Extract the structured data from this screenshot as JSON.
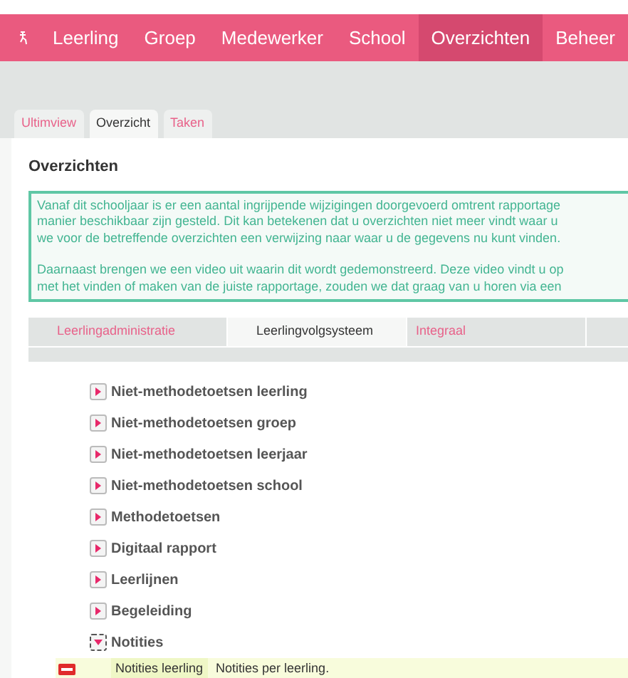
{
  "nav": {
    "items": [
      {
        "label": "Leerling",
        "selected": false
      },
      {
        "label": "Groep",
        "selected": false
      },
      {
        "label": "Medewerker",
        "selected": false
      },
      {
        "label": "School",
        "selected": false
      },
      {
        "label": "Overzichten",
        "selected": true
      },
      {
        "label": "Beheer",
        "selected": false
      }
    ]
  },
  "tabs": [
    {
      "label": "Ultimview",
      "selected": false
    },
    {
      "label": "Overzicht",
      "selected": true
    },
    {
      "label": "Taken",
      "selected": false
    }
  ],
  "title": "Overzichten",
  "notice": {
    "paragraphs": [
      [
        "Vanaf dit schooljaar is er een aantal ingrijpende wijzigingen doorgevoerd omtrent rapportage",
        "manier beschikbaar zijn gesteld. Dit kan betekenen dat u overzichten niet meer vindt waar u",
        "we voor de betreffende overzichten een verwijzing naar waar u de gegevens nu kunt vinden."
      ],
      [
        "Daarnaast brengen we een video uit waarin dit wordt gedemonstreerd. Deze video vindt u op",
        "met het vinden of maken van de juiste rapportage, zouden we dat graag van u horen via een"
      ]
    ]
  },
  "subtabs": [
    {
      "label": "Leerlingadministratie",
      "selected": false
    },
    {
      "label": "Leerlingvolgsysteem",
      "selected": true
    },
    {
      "label": "Integraal",
      "selected": false
    }
  ],
  "tree": [
    {
      "label": "Niet-methodetoetsen leerling",
      "expanded": false
    },
    {
      "label": "Niet-methodetoetsen groep",
      "expanded": false
    },
    {
      "label": "Niet-methodetoetsen leerjaar",
      "expanded": false
    },
    {
      "label": "Niet-methodetoetsen school",
      "expanded": false
    },
    {
      "label": "Methodetoetsen",
      "expanded": false
    },
    {
      "label": "Digitaal rapport",
      "expanded": false
    },
    {
      "label": "Leerlijnen",
      "expanded": false
    },
    {
      "label": "Begeleiding",
      "expanded": false
    },
    {
      "label": "Notities",
      "expanded": true,
      "children": [
        {
          "name": "Notities leerling",
          "description": "Notities per leerling."
        }
      ]
    }
  ]
}
